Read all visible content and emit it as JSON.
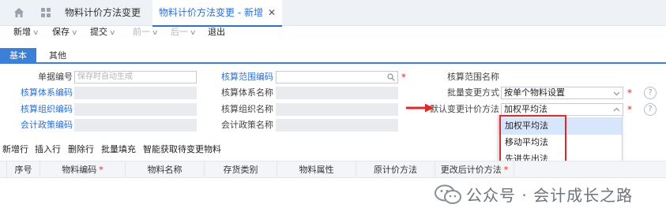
{
  "tabs": [
    {
      "label": "物料计价方法变更",
      "active": false
    },
    {
      "label": "物料计价方法变更 - 新增",
      "active": true
    }
  ],
  "toolbar": {
    "new": "新增",
    "save": "保存",
    "submit": "提交",
    "prev": "前一",
    "next": "后一",
    "exit": "退出"
  },
  "subtabs": {
    "basic": "基本",
    "other": "其他"
  },
  "form": {
    "doc_no": {
      "label": "单据编号",
      "placeholder": "保存时自动生成"
    },
    "acct_sys_code": {
      "label": "核算体系编码",
      "value": ""
    },
    "acct_org_code": {
      "label": "核算组织编码",
      "value": ""
    },
    "acct_policy_code": {
      "label": "会计政策编码",
      "value": ""
    },
    "acct_scope_code": {
      "label": "核算范围编码",
      "value": ""
    },
    "acct_sys_name": {
      "label": "核算体系名称",
      "value": ""
    },
    "acct_org_name": {
      "label": "核算组织名称",
      "value": ""
    },
    "acct_policy_name": {
      "label": "会计政策名称",
      "value": ""
    },
    "acct_scope_name": {
      "label": "核算范围名称",
      "value": ""
    },
    "batch_change_mode": {
      "label": "批量变更方式",
      "value": "按单个物料设置"
    },
    "default_method": {
      "label": "默认变更计价方法",
      "value": "加权平均法"
    },
    "required_mark": "*",
    "help_mark": "?"
  },
  "dropdown": {
    "options": [
      "加权平均法",
      "移动平均法",
      "先进先出法"
    ],
    "selected_index": 0
  },
  "grid_toolbar": {
    "add_row": "新增行",
    "insert_row": "插入行",
    "delete_row": "删除行",
    "batch_fill": "批量填充",
    "smart_fetch": "智能获取待变更物料"
  },
  "table": {
    "columns": [
      "序号",
      "物料编码",
      "物料名称",
      "存货类别",
      "物料属性",
      "原计价方法",
      "更改后计价方法"
    ],
    "required_columns": [
      1,
      6
    ]
  },
  "watermark": {
    "text": "公众号 · 会计成长之路"
  },
  "colors": {
    "accent": "#2d6fd1",
    "tab_active_bg": "#3b7fd6",
    "required": "#e0282b",
    "dropdown_selected": "#d7e6fb"
  }
}
